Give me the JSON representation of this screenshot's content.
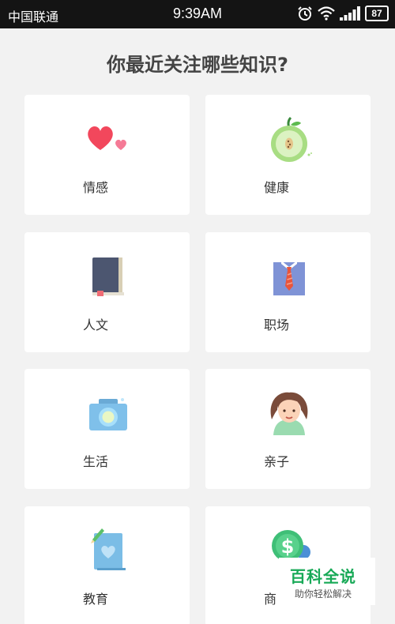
{
  "status_bar": {
    "carrier": "中国联通",
    "time": "9:39AM",
    "battery": "87",
    "icons": [
      "alarm-icon",
      "wifi-icon",
      "signal-icon",
      "battery-icon"
    ]
  },
  "page": {
    "title": "你最近关注哪些知识?"
  },
  "categories": [
    {
      "label": "情感",
      "icon": "hearts-icon"
    },
    {
      "label": "健康",
      "icon": "apple-icon"
    },
    {
      "label": "人文",
      "icon": "book-icon"
    },
    {
      "label": "职场",
      "icon": "shirt-tie-icon"
    },
    {
      "label": "生活",
      "icon": "camera-icon"
    },
    {
      "label": "亲子",
      "icon": "girl-avatar-icon"
    },
    {
      "label": "教育",
      "icon": "notebook-pencil-icon"
    },
    {
      "label": "商",
      "icon": "money-icon"
    }
  ],
  "watermark": {
    "title": "百科全说",
    "subtitle": "助你轻松解决"
  }
}
